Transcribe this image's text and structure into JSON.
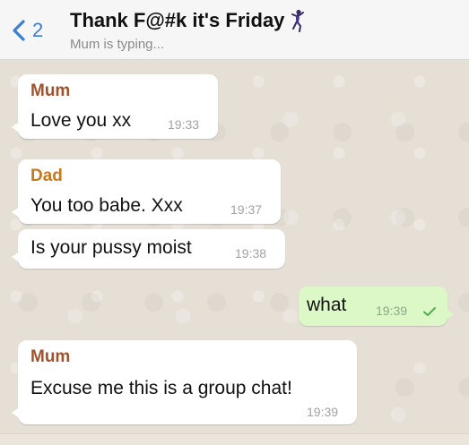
{
  "header": {
    "back_count": "2",
    "title": "Thank F@#k it's Friday",
    "title_icon": "dancing-person-icon",
    "subtitle": "Mum is typing..."
  },
  "colors": {
    "accent": "#3a7fd5",
    "mum_name": "#a0522d",
    "dad_name": "#c8781e",
    "outgoing_bubble": "#dcf8c6",
    "incoming_bubble": "#ffffff",
    "tick": "#4fae4e"
  },
  "messages": [
    {
      "sender": "Mum",
      "text": "Love you xx",
      "time": "19:33"
    },
    {
      "sender": "Dad",
      "text": "You too babe. Xxx",
      "time": "19:37"
    },
    {
      "sender": "",
      "text": "Is your pussy moist",
      "time": "19:38"
    },
    {
      "sender": "",
      "text": "what",
      "time": "19:39",
      "outgoing": true,
      "status_icon": "single-check-icon"
    },
    {
      "sender": "Mum",
      "text": "Excuse me this is a group chat!",
      "time": "19:39"
    }
  ]
}
